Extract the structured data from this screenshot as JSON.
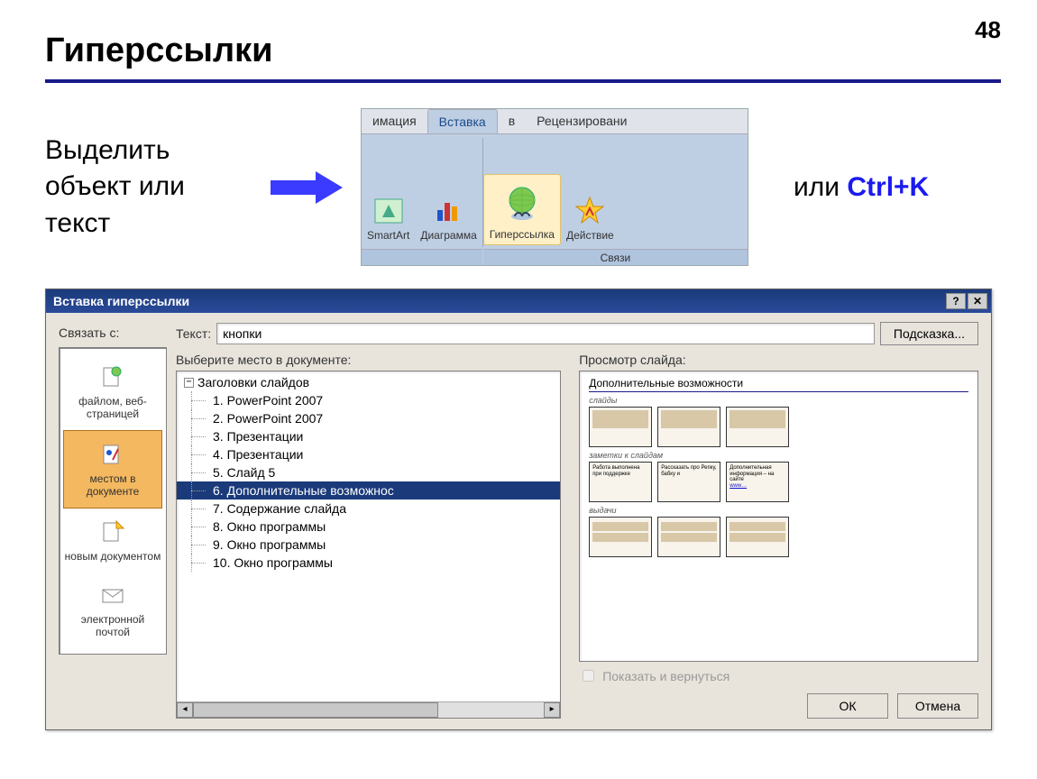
{
  "page_number": "48",
  "heading": "Гиперссылки",
  "instruction": "Выделить объект или текст",
  "ribbon": {
    "tabs": [
      "имация",
      "Вставка",
      "в",
      "Рецензировани"
    ],
    "active_tab_index": 1,
    "groups": {
      "left": {
        "items": [
          {
            "label": "SmartArt"
          },
          {
            "label": "Диаграмма"
          }
        ],
        "caption": ""
      },
      "links": {
        "items": [
          {
            "label": "Гиперссылка",
            "active": true
          },
          {
            "label": "Действие"
          }
        ],
        "caption": "Связи"
      }
    }
  },
  "or_text": "или ",
  "hotkey": "Ctrl+K",
  "dialog": {
    "title": "Вставка гиперссылки",
    "link_with_label": "Связать с:",
    "text_label": "Текст:",
    "text_value": "кнопки",
    "hint_button": "Подсказка...",
    "sidebar": [
      {
        "label": "файлом, веб-страницей",
        "selected": false
      },
      {
        "label": "местом в документе",
        "selected": true
      },
      {
        "label": "новым документом",
        "selected": false
      },
      {
        "label": "электронной почтой",
        "selected": false
      }
    ],
    "tree_label": "Выберите место в документе:",
    "tree_root": "Заголовки слайдов",
    "tree_items": [
      {
        "label": "1. PowerPoint 2007",
        "selected": false
      },
      {
        "label": "2. PowerPoint 2007",
        "selected": false
      },
      {
        "label": "3. Презентации",
        "selected": false
      },
      {
        "label": "4. Презентации",
        "selected": false
      },
      {
        "label": "5. Слайд 5",
        "selected": false
      },
      {
        "label": "6. Дополнительные возможнос",
        "selected": true
      },
      {
        "label": "7. Содержание слайда",
        "selected": false
      },
      {
        "label": "8. Окно программы",
        "selected": false
      },
      {
        "label": "9. Окно программы",
        "selected": false
      },
      {
        "label": "10. Окно программы",
        "selected": false
      }
    ],
    "preview_label": "Просмотр слайда:",
    "preview": {
      "title": "Дополнительные возможности",
      "sections": [
        "слайды",
        "заметки к слайдам",
        "выдачи"
      ],
      "thumbs": [
        {
          "t1": "",
          "t2": "",
          "t3": ""
        },
        {
          "t1": "Работа выполнена при поддержке",
          "t2": "Рассказать про Репку, бабку и",
          "t3": "Дополнительная информация – на сайте"
        },
        {
          "t1": "",
          "t2": "",
          "t3": ""
        }
      ]
    },
    "show_return": "Показать и вернуться",
    "ok": "ОК",
    "cancel": "Отмена"
  }
}
